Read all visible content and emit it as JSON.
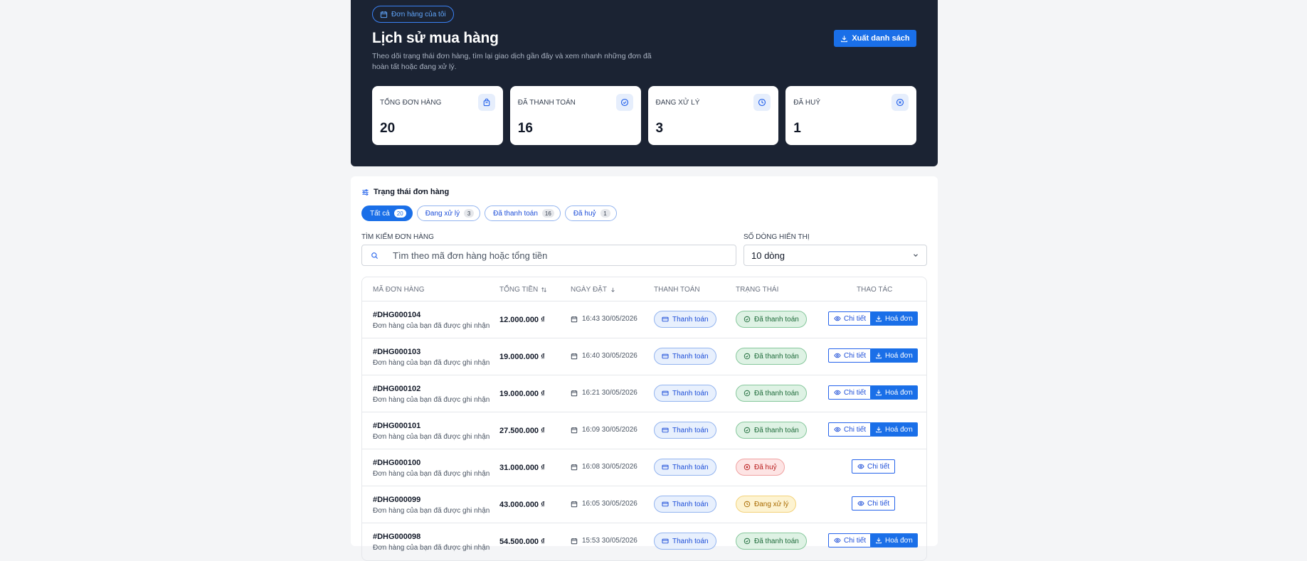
{
  "hero": {
    "chip_label": "Đơn hàng của tôi",
    "title": "Lịch sử mua hàng",
    "description": "Theo dõi trạng thái đơn hàng, tìm lại giao dịch gần đây và xem nhanh những đơn đã hoàn tất hoặc đang xử lý.",
    "export_label": "Xuất danh sách"
  },
  "stats": [
    {
      "label": "Tổng đơn hàng",
      "value": "20",
      "icon": "bag-icon"
    },
    {
      "label": "Đã thanh toán",
      "value": "16",
      "icon": "check-circle-icon"
    },
    {
      "label": "Đang xử lý",
      "value": "3",
      "icon": "clock-icon"
    },
    {
      "label": "Đã huỷ",
      "value": "1",
      "icon": "x-circle-icon"
    }
  ],
  "filter": {
    "title": "Trạng thái đơn hàng",
    "tabs": [
      {
        "label": "Tất cả",
        "count": "20",
        "active": true
      },
      {
        "label": "Đang xử lý",
        "count": "3"
      },
      {
        "label": "Đã thanh toán",
        "count": "16"
      },
      {
        "label": "Đã huỷ",
        "count": "1"
      }
    ]
  },
  "search": {
    "label": "Tìm kiếm đơn hàng",
    "placeholder": "Tìm theo mã đơn hàng hoặc tổng tiền"
  },
  "page_size": {
    "label": "Số dòng hiển thị",
    "value": "10 dòng"
  },
  "table": {
    "headers": {
      "id": "Mã đơn hàng",
      "total": "Tổng tiền",
      "date": "Ngày đặt",
      "payment": "Thanh toán",
      "status": "Trạng thái",
      "actions": "Thao tác"
    },
    "rows": [
      {
        "id": "#DHG000104",
        "note": "Đơn hàng của bạn đã được ghi nhận",
        "total": "12.000.000 ₫",
        "date": "16:43 30/05/2026",
        "payment": "Thanh toán",
        "status": "Đã thanh toán",
        "status_type": "paid",
        "detail": "Chi tiết",
        "invoice": "Hoá đơn"
      },
      {
        "id": "#DHG000103",
        "note": "Đơn hàng của bạn đã được ghi nhận",
        "total": "19.000.000 ₫",
        "date": "16:40 30/05/2026",
        "payment": "Thanh toán",
        "status": "Đã thanh toán",
        "status_type": "paid",
        "detail": "Chi tiết",
        "invoice": "Hoá đơn"
      },
      {
        "id": "#DHG000102",
        "note": "Đơn hàng của bạn đã được ghi nhận",
        "total": "19.000.000 ₫",
        "date": "16:21 30/05/2026",
        "payment": "Thanh toán",
        "status": "Đã thanh toán",
        "status_type": "paid",
        "detail": "Chi tiết",
        "invoice": "Hoá đơn"
      },
      {
        "id": "#DHG000101",
        "note": "Đơn hàng của bạn đã được ghi nhận",
        "total": "27.500.000 ₫",
        "date": "16:09 30/05/2026",
        "payment": "Thanh toán",
        "status": "Đã thanh toán",
        "status_type": "paid",
        "detail": "Chi tiết",
        "invoice": "Hoá đơn"
      },
      {
        "id": "#DHG000100",
        "note": "Đơn hàng của bạn đã được ghi nhận",
        "total": "31.000.000 ₫",
        "date": "16:08 30/05/2026",
        "payment": "Thanh toán",
        "status": "Đã huỷ",
        "status_type": "cancel",
        "detail": "Chi tiết"
      },
      {
        "id": "#DHG000099",
        "note": "Đơn hàng của bạn đã được ghi nhận",
        "total": "43.000.000 ₫",
        "date": "16:05 30/05/2026",
        "payment": "Thanh toán",
        "status": "Đang xử lý",
        "status_type": "proc",
        "detail": "Chi tiết"
      },
      {
        "id": "#DHG000098",
        "note": "Đơn hàng của bạn đã được ghi nhận",
        "total": "54.500.000 ₫",
        "date": "15:53 30/05/2026",
        "payment": "Thanh toán",
        "status": "Đã thanh toán",
        "status_type": "paid",
        "detail": "Chi tiết",
        "invoice": "Hoá đơn"
      }
    ]
  }
}
